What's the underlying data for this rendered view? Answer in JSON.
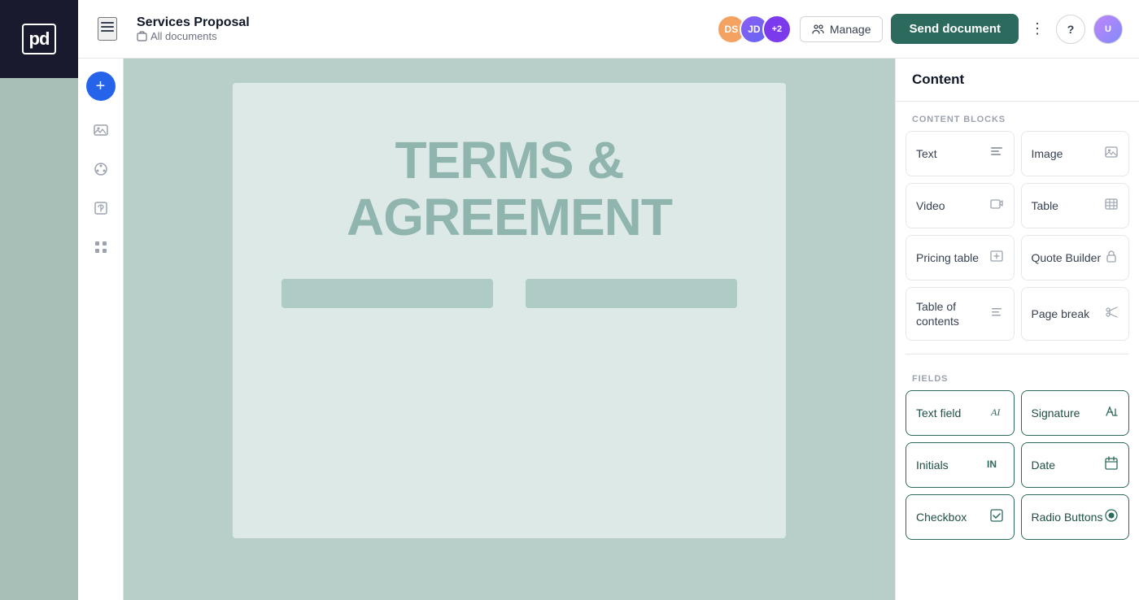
{
  "logo": {
    "text": "pd",
    "aria": "PandaDoc logo"
  },
  "header": {
    "menu_label": "Menu",
    "title": "Services Proposal",
    "subtitle": "All documents",
    "avatars": [
      {
        "initials": "DS",
        "type": "initials",
        "color": "#f4a261"
      },
      {
        "initials": "JD",
        "type": "photo",
        "color": "#8b5cf6"
      },
      {
        "count": "+2",
        "type": "count",
        "color": "#7c3aed"
      }
    ],
    "manage_label": "Manage",
    "send_label": "Send document",
    "more_label": "More options",
    "help_label": "Help",
    "user_label": "User profile"
  },
  "left_sidebar": {
    "icons": [
      {
        "name": "add",
        "label": "Add content",
        "active": true
      },
      {
        "name": "media",
        "label": "Media",
        "active": false
      },
      {
        "name": "theme",
        "label": "Theme",
        "active": false
      },
      {
        "name": "pricing",
        "label": "Pricing",
        "active": false
      },
      {
        "name": "apps",
        "label": "Apps",
        "active": false
      }
    ]
  },
  "document": {
    "title_line1": "TERMS &",
    "title_line2": "AGREEMENT"
  },
  "panel": {
    "title": "Content",
    "content_blocks_label": "CONTENT BLOCKS",
    "fields_label": "FIELDS",
    "blocks": [
      {
        "id": "text",
        "label": "Text",
        "icon": "text"
      },
      {
        "id": "image",
        "label": "Image",
        "icon": "image"
      },
      {
        "id": "video",
        "label": "Video",
        "icon": "video"
      },
      {
        "id": "table",
        "label": "Table",
        "icon": "table"
      },
      {
        "id": "pricing-table",
        "label": "Pricing table",
        "icon": "pricing"
      },
      {
        "id": "quote-builder",
        "label": "Quote Builder",
        "icon": "lock"
      },
      {
        "id": "table-of-contents",
        "label": "Table of contents",
        "icon": "list"
      },
      {
        "id": "page-break",
        "label": "Page break",
        "icon": "scissors"
      }
    ],
    "fields": [
      {
        "id": "text-field",
        "label": "Text field",
        "icon": "ai"
      },
      {
        "id": "signature",
        "label": "Signature",
        "icon": "edit"
      },
      {
        "id": "initials",
        "label": "Initials",
        "icon": "in"
      },
      {
        "id": "date",
        "label": "Date",
        "icon": "calendar"
      },
      {
        "id": "checkbox",
        "label": "Checkbox",
        "icon": "checkbox"
      },
      {
        "id": "radio-buttons",
        "label": "Radio Buttons",
        "icon": "radio"
      }
    ]
  }
}
